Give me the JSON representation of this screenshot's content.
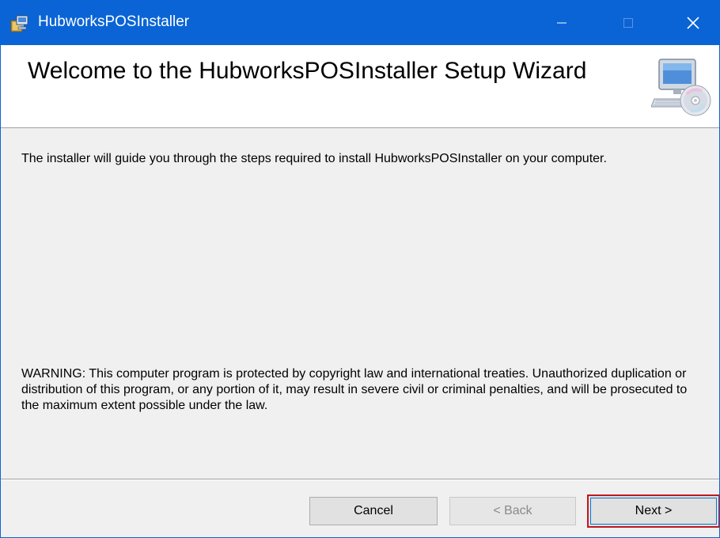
{
  "window": {
    "title": "HubworksPOSInstaller"
  },
  "titlebar_buttons": {
    "minimize_icon": "minimize-icon",
    "maximize_icon": "maximize-icon",
    "close_icon": "close-icon"
  },
  "header": {
    "title": "Welcome to the HubworksPOSInstaller Setup Wizard",
    "icon": "computer-disc-icon"
  },
  "body": {
    "intro": "The installer will guide you through the steps required to install HubworksPOSInstaller on your computer.",
    "warning": "WARNING: This computer program is protected by copyright law and international treaties. Unauthorized duplication or distribution of this program, or any portion of it, may result in severe civil or criminal penalties, and will be prosecuted to the maximum extent possible under the law."
  },
  "buttons": {
    "cancel": "Cancel",
    "back": "< Back",
    "next": "Next >"
  },
  "colors": {
    "titlebar": "#0a64d6",
    "highlight": "#c0181e"
  }
}
